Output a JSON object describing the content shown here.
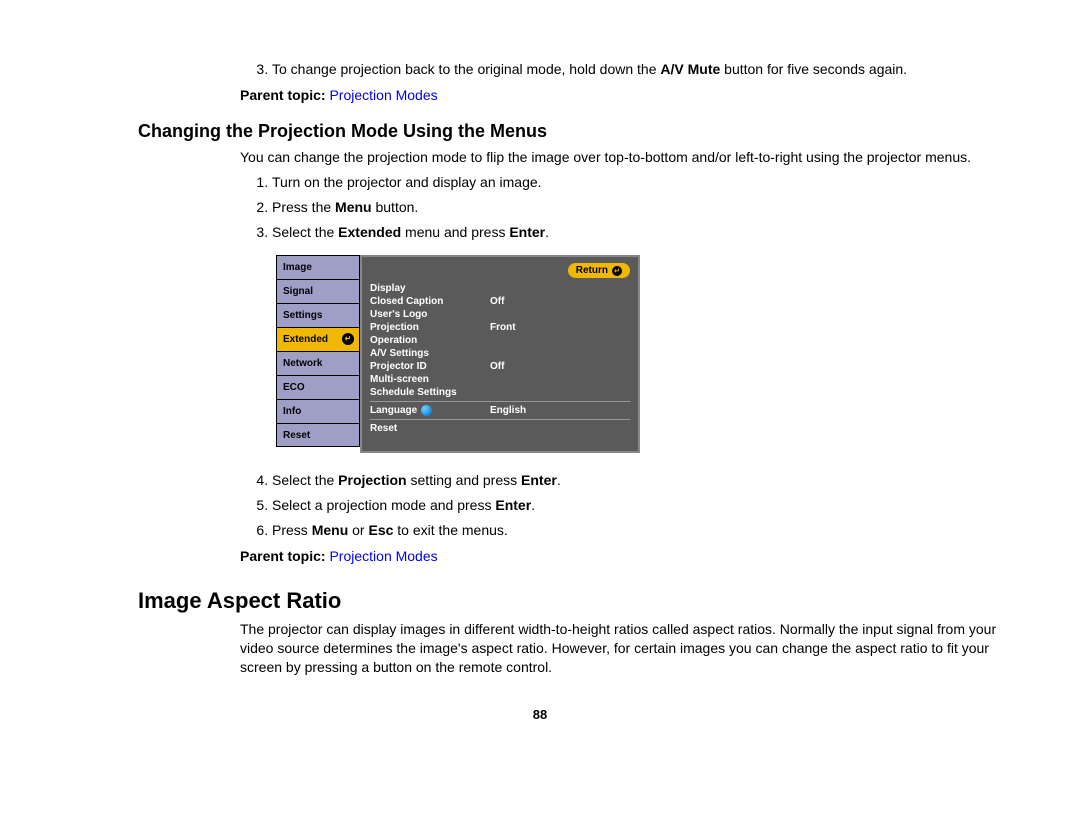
{
  "step3": {
    "num": "3.",
    "text_a": "To change projection back to the original mode, hold down the ",
    "text_b": "A/V Mute",
    "text_c": " button for five seconds again."
  },
  "parent_topic_label": "Parent topic: ",
  "parent_topic_link": "Projection Modes",
  "heading_changing": "Changing the Projection Mode Using the Menus",
  "intro_changing": "You can change the projection mode to flip the image over top-to-bottom and/or left-to-right using the projector menus.",
  "steps_a": {
    "s1": "Turn on the projector and display an image.",
    "s2a": "Press the ",
    "s2b": "Menu",
    "s2c": " button.",
    "s3a": "Select the ",
    "s3b": "Extended",
    "s3c": " menu and press ",
    "s3d": "Enter",
    "s3e": "."
  },
  "steps_b": {
    "s4a": "Select the ",
    "s4b": "Projection",
    "s4c": " setting and press ",
    "s4d": "Enter",
    "s4e": ".",
    "s5a": "Select a projection mode and press ",
    "s5b": "Enter",
    "s5c": ".",
    "s6a": "Press ",
    "s6b": "Menu",
    "s6c": " or ",
    "s6d": "Esc",
    "s6e": " to exit the menus."
  },
  "heading_aspect": "Image Aspect Ratio",
  "aspect_body": "The projector can display images in different width-to-height ratios called aspect ratios. Normally the input signal from your video source determines the image's aspect ratio. However, for certain images you can change the aspect ratio to fit your screen by pressing a button on the remote control.",
  "page_number": "88",
  "osd": {
    "return_label": "Return",
    "tabs": [
      "Image",
      "Signal",
      "Settings",
      "Extended",
      "Network",
      "ECO",
      "Info",
      "Reset"
    ],
    "selected_tab": "Extended",
    "rows": [
      {
        "label": "Display",
        "value": ""
      },
      {
        "label": "Closed Caption",
        "value": "Off"
      },
      {
        "label": "User's Logo",
        "value": ""
      },
      {
        "label": "Projection",
        "value": "Front"
      },
      {
        "label": "Operation",
        "value": ""
      },
      {
        "label": "A/V Settings",
        "value": ""
      },
      {
        "label": "Projector ID",
        "value": "Off"
      },
      {
        "label": "Multi-screen",
        "value": ""
      },
      {
        "label": "Schedule Settings",
        "value": ""
      },
      {
        "label": "Language",
        "value": "English",
        "icon": "globe"
      },
      {
        "label": "Reset",
        "value": ""
      }
    ]
  }
}
